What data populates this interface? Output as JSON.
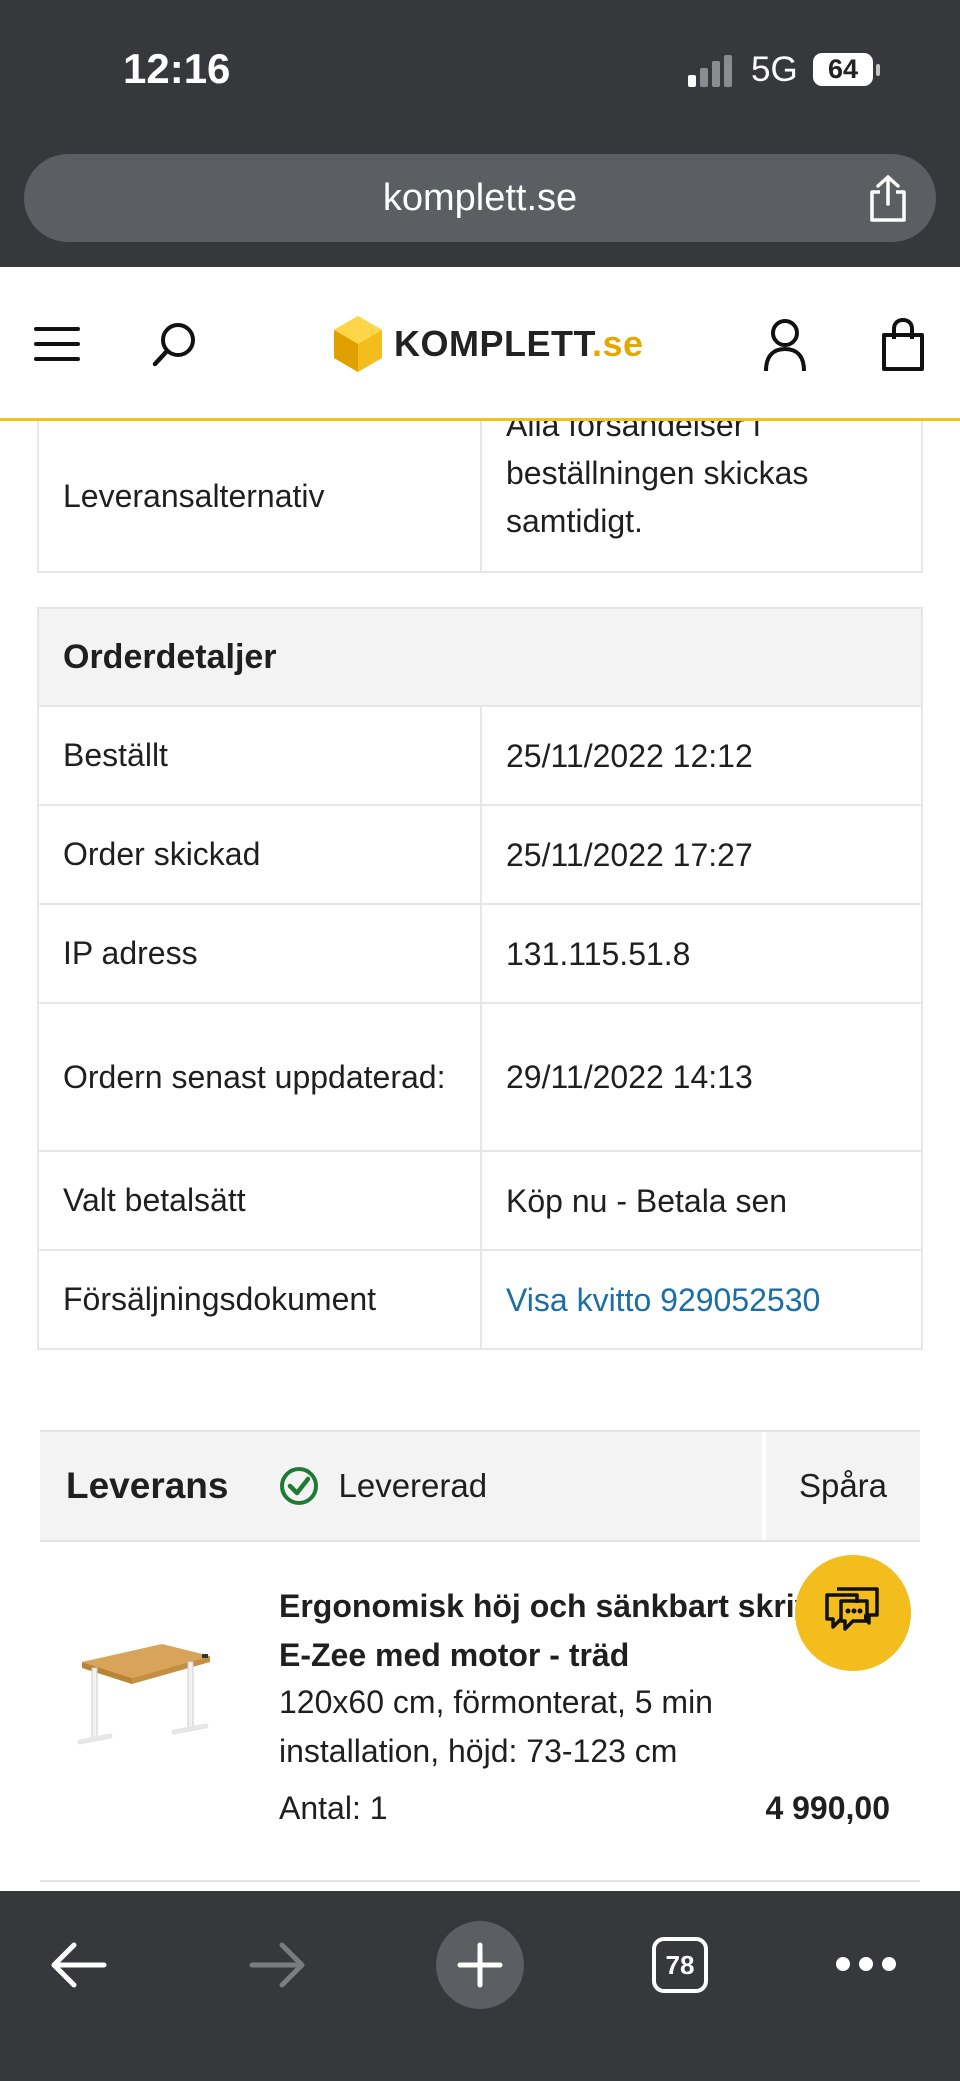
{
  "status_bar": {
    "time": "12:16",
    "network": "5G",
    "battery": "64"
  },
  "browser": {
    "url": "komplett.se",
    "tab_count": "78"
  },
  "site": {
    "logo_main": "KOMPLETT",
    "logo_suffix": ".se"
  },
  "delivery_option": {
    "label": "Leveransalternativ",
    "value": "Alla försändelser i beställningen skickas samtidigt."
  },
  "order_details": {
    "title": "Orderdetaljer",
    "rows": [
      {
        "label": "Beställt",
        "value": "25/11/2022 12:12"
      },
      {
        "label": "Order skickad",
        "value": "25/11/2022 17:27"
      },
      {
        "label": "IP adress",
        "value": "131.115.51.8"
      },
      {
        "label": "Ordern senast uppdaterad:",
        "value": "29/11/2022 14:13"
      },
      {
        "label": "Valt betalsätt",
        "value": "Köp nu - Betala sen"
      },
      {
        "label": "Försäljningsdokument",
        "value": "Visa kvitto 929052530"
      }
    ]
  },
  "delivery": {
    "title": "Leverans",
    "status": "Levererad",
    "track_label": "Spåra",
    "product": {
      "name_line1": "Ergonomisk höj och sänkbart skrivbord",
      "name_line2": "E-Zee med motor - träd",
      "description": "120x60 cm, förmonterat, 5 min installation, höjd: 73-123 cm",
      "quantity": "Antal: 1",
      "price": "4 990,00"
    }
  },
  "colors": {
    "accent": "#f4bd1e",
    "link": "#1a6fa8",
    "success": "#1e7b34",
    "chrome": "#36383b"
  }
}
